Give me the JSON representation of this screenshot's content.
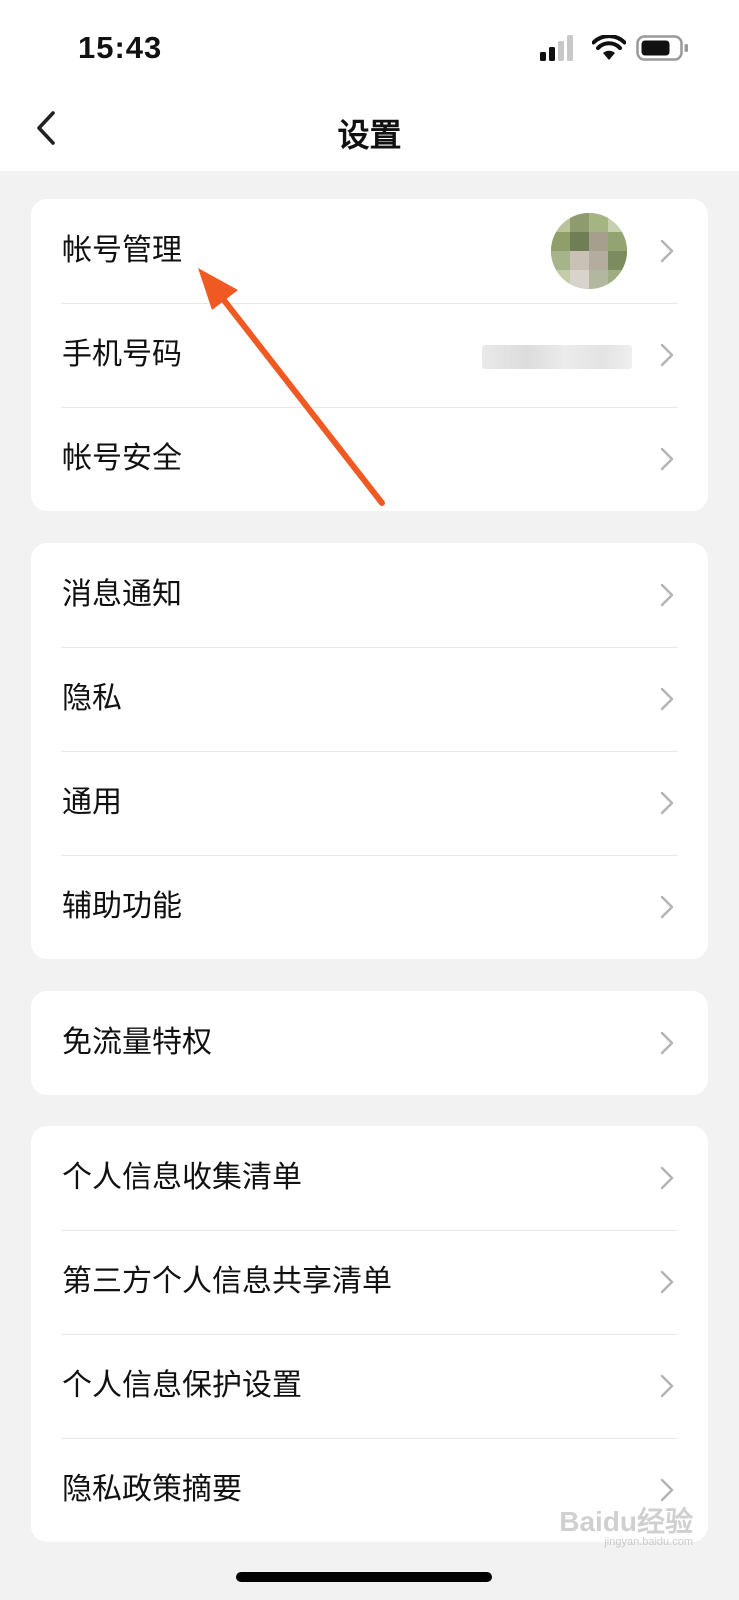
{
  "status_bar": {
    "time": "15:43",
    "icons": [
      "signal-icon",
      "wifi-icon",
      "battery-icon"
    ]
  },
  "nav": {
    "title": "设置",
    "back_icon": "chevron-left-icon"
  },
  "groups": [
    {
      "items": [
        {
          "label": "帐号管理",
          "trailing": "avatar"
        },
        {
          "label": "手机号码",
          "trailing": "masked-phone"
        },
        {
          "label": "帐号安全"
        }
      ]
    },
    {
      "items": [
        {
          "label": "消息通知"
        },
        {
          "label": "隐私"
        },
        {
          "label": "通用"
        },
        {
          "label": "辅助功能"
        }
      ]
    },
    {
      "items": [
        {
          "label": "免流量特权"
        }
      ]
    },
    {
      "items": [
        {
          "label": "个人信息收集清单"
        },
        {
          "label": "第三方个人信息共享清单"
        },
        {
          "label": "个人信息保护设置"
        },
        {
          "label": "隐私政策摘要"
        }
      ]
    }
  ],
  "annotation": {
    "color": "#f05a22",
    "points_to": "帐号管理"
  },
  "watermark": {
    "text": "Baidu经验",
    "sub": "jingyan.baidu.com"
  },
  "colors": {
    "background": "#f2f2f2",
    "card": "#ffffff",
    "divider": "#e8e8e8",
    "chevron": "#b3b3b3"
  }
}
